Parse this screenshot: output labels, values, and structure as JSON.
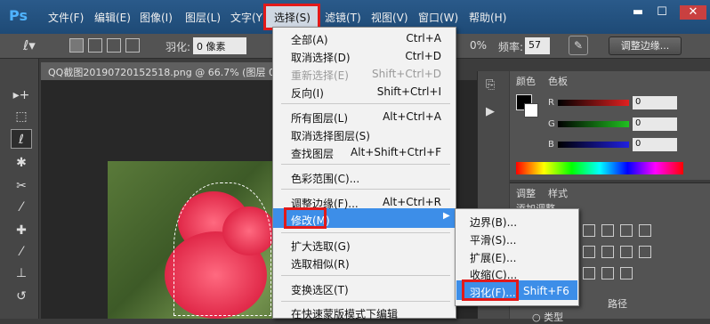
{
  "app_logo": "Ps",
  "menubar": {
    "items": [
      "文件(F)",
      "编辑(E)",
      "图像(I)",
      "图层(L)",
      "文字(Y)",
      "选择(S)",
      "滤镜(T)",
      "视图(V)",
      "窗口(W)",
      "帮助(H)"
    ],
    "window_buttons": [
      "▬",
      "☐",
      "✕"
    ]
  },
  "options": {
    "feather_label": "羽化:",
    "feather_value": "0 像素",
    "pct_text": "0%",
    "freq_label": "频率:",
    "freq_value": "57",
    "refine_label": "调整边缘..."
  },
  "document": {
    "tab_title": "QQ截图20190720152518.png @ 66.7% (图层 0,"
  },
  "panels": {
    "color_tabs": [
      "颜色",
      "色板"
    ],
    "rgb": [
      {
        "label": "R",
        "value": "0",
        "color": "#e02020"
      },
      {
        "label": "G",
        "value": "0",
        "color": "#20c020"
      },
      {
        "label": "B",
        "value": "0",
        "color": "#2020e0"
      }
    ],
    "adj_tabs": [
      "调整",
      "样式"
    ],
    "adj_title": "添加调整",
    "bottom_tab": "路径",
    "bottom_text": "○ 类型"
  },
  "select_menu": {
    "items": [
      {
        "label": "全部(A)",
        "shortcut": "Ctrl+A",
        "disabled": false
      },
      {
        "label": "取消选择(D)",
        "shortcut": "Ctrl+D",
        "disabled": false
      },
      {
        "label": "重新选择(E)",
        "shortcut": "Shift+Ctrl+D",
        "disabled": true
      },
      {
        "label": "反向(I)",
        "shortcut": "Shift+Ctrl+I",
        "disabled": false
      },
      {
        "label": "所有图层(L)",
        "shortcut": "Alt+Ctrl+A",
        "disabled": false
      },
      {
        "label": "取消选择图层(S)",
        "shortcut": "",
        "disabled": false
      },
      {
        "label": "查找图层",
        "shortcut": "Alt+Shift+Ctrl+F",
        "disabled": false
      },
      {
        "label": "色彩范围(C)...",
        "shortcut": "",
        "disabled": false
      },
      {
        "label": "调整边缘(F)...",
        "shortcut": "Alt+Ctrl+R",
        "disabled": false
      },
      {
        "label": "修改(M)",
        "shortcut": "",
        "disabled": false
      },
      {
        "label": "扩大选取(G)",
        "shortcut": "",
        "disabled": false
      },
      {
        "label": "选取相似(R)",
        "shortcut": "",
        "disabled": false
      },
      {
        "label": "变换选区(T)",
        "shortcut": "",
        "disabled": false
      },
      {
        "label": "在快速蒙版模式下编辑",
        "shortcut": "",
        "disabled": false
      }
    ]
  },
  "modify_submenu": {
    "items": [
      {
        "label": "边界(B)...",
        "shortcut": ""
      },
      {
        "label": "平滑(S)...",
        "shortcut": ""
      },
      {
        "label": "扩展(E)...",
        "shortcut": ""
      },
      {
        "label": "收缩(C)...",
        "shortcut": ""
      },
      {
        "label": "羽化(F)...",
        "shortcut": "Shift+F6"
      }
    ]
  },
  "colors": {
    "highlight": "#3d8ee8",
    "annotation_red": "#e21a1a",
    "menubar_blue": "#1e4a76"
  }
}
